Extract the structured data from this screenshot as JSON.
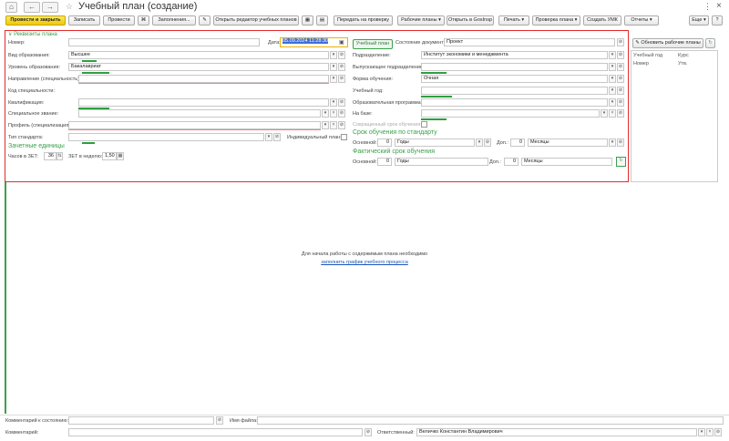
{
  "window": {
    "title": "Учебный план (создание)",
    "nav": {
      "home": "⌂",
      "back": "←",
      "forward": "→",
      "star": "☆"
    },
    "menu": "⋮",
    "close": "×"
  },
  "toolbar": {
    "post_close": "Провести и закрыть",
    "save": "Записать",
    "post": "Провести",
    "fill": "Заполнения...",
    "open_editor": "Открыть редактор учебных планов",
    "send_check": "Передать на проверку",
    "work_plans": "Рабочие планы ▾",
    "open_gosinsp": "Открыть в GosInsp",
    "print": "Печать ▾",
    "check_plan": "Проверка плана ▾",
    "create_umk": "Создать УМК",
    "reports": "Отчеты ▾",
    "more": "Еще ▾",
    "help": "?"
  },
  "section_requisites": "Реквизиты плана",
  "left": {
    "number_label": "Номер:",
    "number_value": "",
    "date_label": "Дата:",
    "date_value": "05.09.2024 11:28:30",
    "education_kind_label": "Вид образования:",
    "education_kind_value": "Высшее",
    "education_level_label": "Уровень образования:",
    "education_level_value": "Бакалавриат",
    "direction_label": "Направление (специальность):",
    "direction_value": "",
    "specialty_code_label": "Код специальности:",
    "qualification_label": "Квалификация:",
    "qualification_value": "",
    "special_title_label": "Специальное звание:",
    "special_title_value": "",
    "profile_label": "Профиль (специализация):",
    "profile_value": "",
    "standard_type_label": "Тип стандарта:",
    "standard_type_value": "",
    "individual_plan_label": "Индивидуальный план:",
    "credit_units_title": "Зачетные единицы",
    "hours_per_zet_label": "Часов в ЗЕТ:",
    "hours_per_zet_value": "36",
    "zet_per_week_label": "ЗЕТ в неделю:",
    "zet_per_week_value": "1,50"
  },
  "right": {
    "plan_tag": "Учебный план",
    "doc_state_label": "Состояние документа:",
    "doc_state_value": "Проект",
    "department_label": "Подразделение:",
    "department_value": "Институт экономики и менеджмента",
    "graduating_label": "Выпускающее подразделение:",
    "graduating_value": "",
    "study_form_label": "Форма обучения:",
    "study_form_value": "Очная",
    "study_year_label": "Учебный год:",
    "study_year_value": "",
    "program_label": "Образовательная программа:",
    "program_value": "",
    "basis_label": "На базе:",
    "basis_value": "",
    "reduced_term_label": "Сокращенный срок обучения:",
    "standard_term_title": "Срок обучения по стандарту",
    "main_label": "Основной:",
    "main_value": "0",
    "years_unit": "Годы",
    "extra_label": "Доп.:",
    "extra_value": "0",
    "months_unit": "Месяцы",
    "actual_term_title": "Фактический срок обучения",
    "actual_main_label": "Основной:",
    "actual_main_value": "0",
    "actual_extra_label": "Доп.:",
    "actual_extra_value": "0"
  },
  "side_panel": {
    "update_btn": "Обновить рабочие планы",
    "col_year": "Учебный год",
    "col_course": "Курс",
    "row_label": "Номер",
    "row_value": "Утв."
  },
  "center": {
    "message": "Для начала работы с содержимым плана необходимо",
    "link": "заполнить график учебного процесса"
  },
  "footer": {
    "state_comment_label": "Комментарий к состоянию:",
    "state_comment_value": "",
    "file_name_label": "Имя файла:",
    "file_name_value": "",
    "comment_label": "Комментарий:",
    "comment_value": "",
    "responsible_label": "Ответственный:",
    "responsible_value": "Величко Константин Владимирович"
  }
}
